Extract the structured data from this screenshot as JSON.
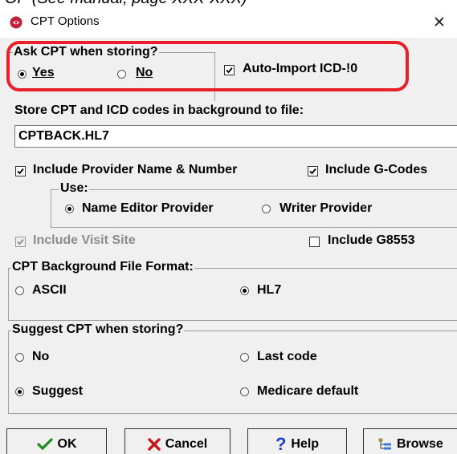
{
  "caption_text": "OP (See manual, page XXX-XXX)",
  "window": {
    "title": "CPT Options",
    "close_glyph": "✕",
    "icon": "app-icon"
  },
  "ask_cpt": {
    "label": "Ask CPT when storing?",
    "options": [
      {
        "label": "Yes",
        "selected": true
      },
      {
        "label": "No",
        "selected": false
      }
    ]
  },
  "auto_import": {
    "label": "Auto-Import ICD-!0",
    "checked": true
  },
  "background_store": {
    "label": "Store CPT and ICD codes in background to file:",
    "filename": "CPTBACK.HL7"
  },
  "include_provider": {
    "label": "Include Provider Name & Number",
    "checked": true
  },
  "include_gcodes": {
    "label": "Include G-Codes",
    "checked": true
  },
  "use_group": {
    "label": "Use:",
    "options": [
      {
        "label": "Name Editor Provider",
        "selected": true
      },
      {
        "label": "Writer Provider",
        "selected": false
      }
    ]
  },
  "include_visit_site": {
    "label": "Include Visit Site",
    "checked": true,
    "disabled": true
  },
  "include_g8553": {
    "label": "Include G8553",
    "checked": false
  },
  "file_format": {
    "label": "CPT Background File Format:",
    "options": [
      {
        "label": "ASCII",
        "selected": false
      },
      {
        "label": "HL7",
        "selected": true
      }
    ]
  },
  "suggest": {
    "label": "Suggest CPT when storing?",
    "options": [
      {
        "label": "No",
        "selected": false
      },
      {
        "label": "Last code",
        "selected": false
      },
      {
        "label": "Suggest",
        "selected": true
      },
      {
        "label": "Medicare default",
        "selected": false
      }
    ]
  },
  "buttons": {
    "ok": "OK",
    "cancel": "Cancel",
    "help": "Help",
    "browse": "Browse"
  },
  "colors": {
    "highlight": "#e8202a",
    "ok_check": "#1f8a1f",
    "cancel_x": "#c61a1a",
    "help": "#1e3cc8",
    "icon_red": "#c0203a"
  }
}
